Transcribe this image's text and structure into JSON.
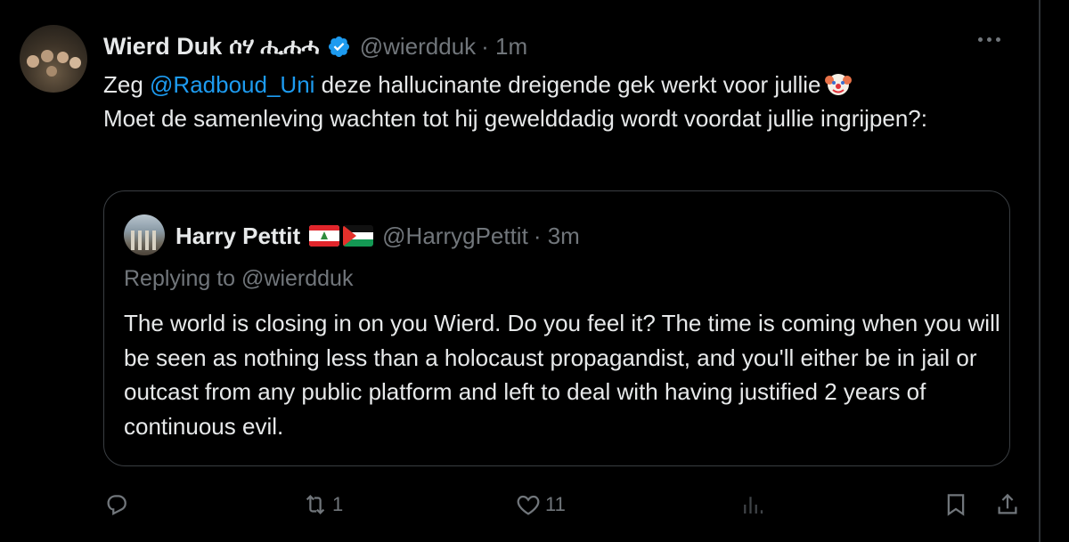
{
  "tweet": {
    "author_name": "Wierd Duk",
    "author_name_glyphs": "ሰሃ ሒሐሓ",
    "handle": "@wierdduk",
    "time": "· 1m",
    "text_part1": "Zeg ",
    "mention": "@Radboud_Uni",
    "text_part2": " deze hallucinante dreigende gek werkt voor jullie",
    "text_line2": "Moet de samenleving wachten tot hij gewelddadig wordt voordat jullie ingrijpen?:"
  },
  "quote": {
    "author_name": "Harry Pettit",
    "handle": "@HarrygPettit",
    "time": "· 3m",
    "replying_to": "Replying to @wierdduk",
    "text": "The world is closing in on you Wierd. Do you feel it? The time is coming when you will be seen as nothing less than a holocaust propagandist, and you'll either be in jail or outcast from any public platform and left to deal with having justified 2 years of continuous evil."
  },
  "actions": {
    "reply_count": "",
    "retweet_count": "1",
    "like_count": "11",
    "views_count": ""
  },
  "icons": {
    "verified": "verified-badge-icon",
    "more": "more-options-icon",
    "reply": "reply-icon",
    "retweet": "retweet-icon",
    "like": "like-icon",
    "views": "views-icon",
    "bookmark": "bookmark-icon",
    "share": "share-icon",
    "clown": "clown-emoji-icon",
    "flag_lebanon": "lebanon-flag-icon",
    "flag_palestine": "palestine-flag-icon"
  },
  "colors": {
    "background": "#000000",
    "text": "#e7e9ea",
    "secondary": "#71767b",
    "link": "#1d9bf0",
    "border": "#2f3336"
  }
}
